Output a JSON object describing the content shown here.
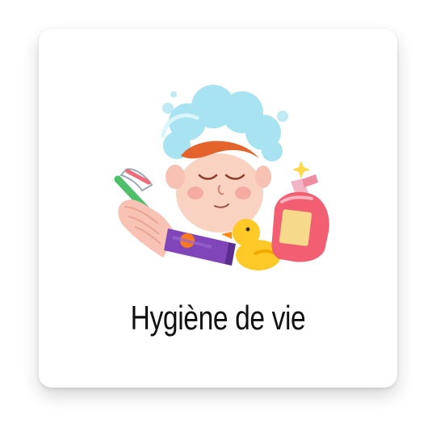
{
  "card": {
    "title": "Hygiène de vie",
    "illustration": {
      "subject": "hygiene-illustration",
      "elements": [
        "soap-foam-hair-icon",
        "child-face-icon",
        "toothbrush-icon",
        "hand-icon",
        "toothpaste-tube-icon",
        "rubber-duck-icon",
        "soap-bottle-icon",
        "sparkle-icon",
        "bubble-icon"
      ]
    }
  },
  "colors": {
    "foam": "#a7e3f0",
    "skin": "#f9d2c2",
    "hair": "#e4622c",
    "toothbrush": "#4fbf6a",
    "tube": "#8046b9",
    "duck": "#ffc928",
    "bottle": "#f25f73",
    "label": "#f6d98b",
    "title": "#111111"
  }
}
